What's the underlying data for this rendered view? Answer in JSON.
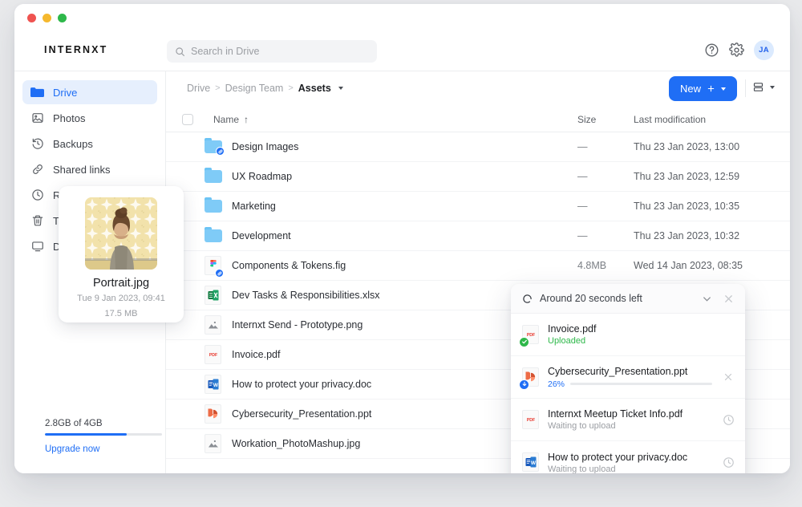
{
  "window": {
    "traffic_lights": [
      "close",
      "minimize",
      "maximize"
    ]
  },
  "header": {
    "brand": "INTERNXT",
    "search": {
      "placeholder": "Search in Drive",
      "value": ""
    },
    "help_icon": "question-circle-icon",
    "settings_icon": "gear-icon",
    "avatar_initials": "JA"
  },
  "sidebar": {
    "items": [
      {
        "label": "Drive",
        "icon": "folder-icon",
        "active": true
      },
      {
        "label": "Photos",
        "icon": "image-icon",
        "active": false
      },
      {
        "label": "Backups",
        "icon": "clock-rewind-icon",
        "active": false
      },
      {
        "label": "Shared links",
        "icon": "link-icon",
        "active": false
      },
      {
        "label": "Recents",
        "icon": "clock-icon",
        "active": false
      },
      {
        "label": "Trash",
        "icon": "trash-icon",
        "active": false
      },
      {
        "label": "Desktop App",
        "icon": "monitor-icon",
        "active": false
      }
    ],
    "preview": {
      "name": "Portrait.jpg",
      "date": "Tue 9 Jan 2023, 09:41",
      "size": "17.5 MB"
    },
    "storage": {
      "text": "2.8GB of 4GB",
      "used_percent": 70,
      "upgrade_label": "Upgrade now",
      "accent": "#1f6ef5"
    }
  },
  "toolbar": {
    "breadcrumb": [
      "Drive",
      "Design Team",
      "Assets"
    ],
    "breadcrumb_separator": ">",
    "new_label": "New",
    "view_toggle_icon": "list-view-icon"
  },
  "table": {
    "columns": {
      "name": "Name",
      "size": "Size",
      "modified": "Last modification"
    },
    "sort_arrow": "↑",
    "rows": [
      {
        "name": "Design Images",
        "size": "—",
        "modified": "Thu 23 Jan 2023, 13:00",
        "icon": "folder-icon",
        "shared": true
      },
      {
        "name": "UX Roadmap",
        "size": "—",
        "modified": "Thu 23 Jan 2023, 12:59",
        "icon": "folder-icon",
        "shared": false
      },
      {
        "name": "Marketing",
        "size": "—",
        "modified": "Thu 23 Jan 2023, 10:35",
        "icon": "folder-icon",
        "shared": false
      },
      {
        "name": "Development",
        "size": "—",
        "modified": "Thu 23 Jan 2023, 10:32",
        "icon": "folder-icon",
        "shared": false
      },
      {
        "name": "Components & Tokens.fig",
        "size": "4.8MB",
        "modified": "Wed 14 Jan 2023, 08:35",
        "icon": "figma-file-icon",
        "shared": true
      },
      {
        "name": "Dev Tasks & Responsibilities.xlsx",
        "size": "",
        "modified": "",
        "icon": "excel-file-icon",
        "shared": false
      },
      {
        "name": "Internxt Send - Prototype.png",
        "size": "",
        "modified": "",
        "icon": "image-file-icon",
        "shared": false
      },
      {
        "name": "Invoice.pdf",
        "size": "",
        "modified": "",
        "icon": "pdf-file-icon",
        "shared": false
      },
      {
        "name": "How to protect your privacy.doc",
        "size": "",
        "modified": "",
        "icon": "word-file-icon",
        "shared": false
      },
      {
        "name": "Cybersecurity_Presentation.ppt",
        "size": "",
        "modified": "",
        "icon": "powerpoint-file-icon",
        "shared": false
      },
      {
        "name": "Workation_PhotoMashup.jpg",
        "size": "",
        "modified": "",
        "icon": "image-file-icon",
        "shared": false
      }
    ]
  },
  "uploads": {
    "title": "Around 20 seconds left",
    "collapse_icon": "chevron-down-icon",
    "close_icon": "close-icon",
    "items": [
      {
        "name": "Invoice.pdf",
        "status": "Uploaded",
        "state": "done",
        "icon": "pdf-file-icon"
      },
      {
        "name": "Cybersecurity_Presentation.ppt",
        "status": "",
        "state": "uploading",
        "percent": 26,
        "percent_label": "26%",
        "icon": "powerpoint-file-icon"
      },
      {
        "name": "Internxt Meetup Ticket Info.pdf",
        "status": "Waiting to upload",
        "state": "waiting",
        "icon": "pdf-file-icon"
      },
      {
        "name": "How to protect your privacy.doc",
        "status": "Waiting to upload",
        "state": "waiting",
        "icon": "word-file-icon"
      }
    ]
  }
}
